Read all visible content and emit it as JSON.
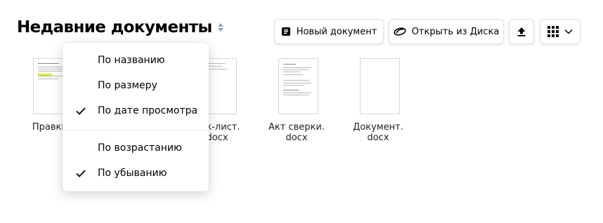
{
  "header": {
    "title": "Недавние документы"
  },
  "toolbar": {
    "new_document_label": "Новый документ",
    "open_from_disk_label": "Открыть из Диска"
  },
  "files": [
    {
      "name_line1": "Правки.d",
      "name_line2": ""
    },
    {
      "name_line1": "Чек-лист.",
      "name_line2": "docx"
    },
    {
      "name_line1": "Акт сверки.",
      "name_line2": "docx"
    },
    {
      "name_line1": "Документ.",
      "name_line2": "docx"
    }
  ],
  "sort_menu": {
    "items": [
      {
        "label": "По названию",
        "checked": false
      },
      {
        "label": "По размеру",
        "checked": false
      },
      {
        "label": "По дате просмотра",
        "checked": true
      }
    ],
    "order_items": [
      {
        "label": "По возрастанию",
        "checked": false
      },
      {
        "label": "По убыванию",
        "checked": true
      }
    ]
  },
  "icons": {
    "sort_toggle": "sort-arrows-icon",
    "new_document": "document-icon",
    "open_from_disk": "disk-icon",
    "upload": "upload-icon",
    "view": "grid-icon",
    "view_menu": "chevron-down-icon",
    "check": "check-icon"
  }
}
